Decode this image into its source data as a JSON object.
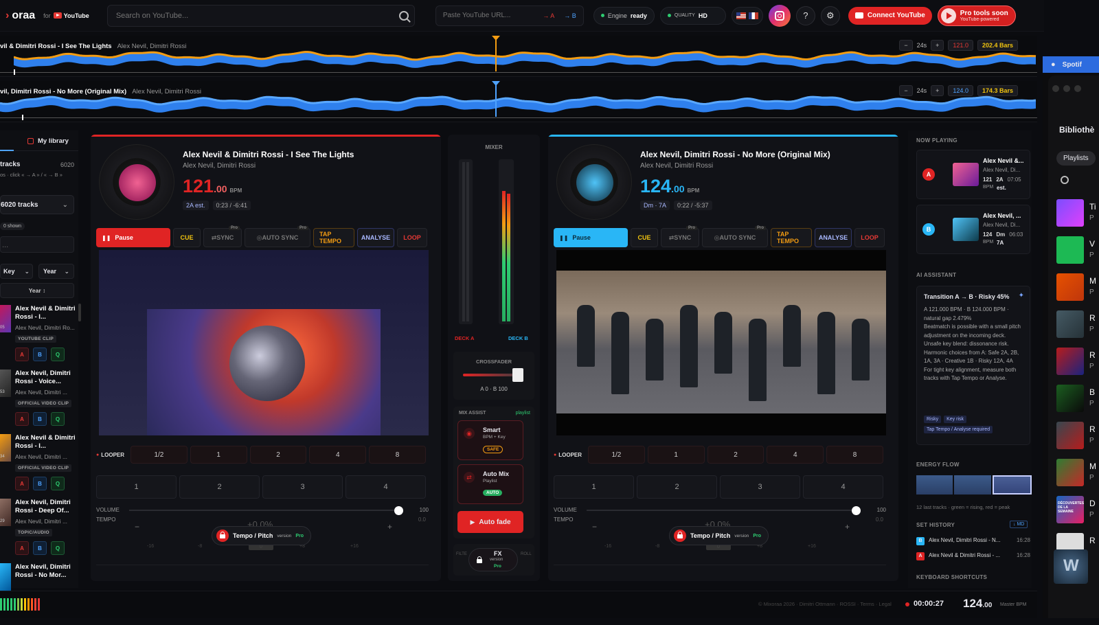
{
  "header": {
    "logo": "oraa",
    "logo_prefix": "",
    "for_label": "for",
    "youtube_label": "YouTube",
    "search_placeholder": "Search on YouTube...",
    "url_placeholder": "Paste YouTube URL...",
    "to_a": "→ A",
    "to_b": "→ B",
    "engine_label": "Engine",
    "engine_status": "ready",
    "quality_label": "QUALITY",
    "quality_value": "HD",
    "connect_label": "Connect YouTube",
    "pro_title": "Pro tools soon",
    "pro_sub": "YouTube-powered"
  },
  "waveforms": [
    {
      "title": "vil & Dimitri Rossi - I See The Lights",
      "artist": "Alex Nevil, Dimitri Rossi",
      "window": "24s",
      "bpm": "121.0",
      "bars": "202.4 Bars"
    },
    {
      "title": "vil, Dimitri Rossi - No More (Original Mix)",
      "artist": "Alex Nevil, Dimitri Rossi",
      "window": "24s",
      "bpm": "124.0",
      "bars": "174.3 Bars"
    }
  ],
  "sidebar": {
    "tab_label": "My library",
    "tracks_label": "tracks",
    "tracks_count": "6020",
    "hint": "os · click « → A » / « → B »",
    "dropdown": "6020 tracks",
    "shown_label": "0 shown",
    "filter_key": "Key",
    "filter_year": "Year",
    "sort_label": "Year ↕",
    "items": [
      {
        "title": "Alex Nevil & Dimitri Rossi - I...",
        "artist": "Alex Nevil, Dimitri Ro...",
        "tag": "YOUTUBE CLIP",
        "num": "05"
      },
      {
        "title": "Alex Nevil, Dimitri Rossi - Voice...",
        "artist": "Alex Nevil, Dimitri ...",
        "tag": "OFFICIAL VIDEO CLIP",
        "num": "53"
      },
      {
        "title": "Alex Nevil & Dimitri Rossi - I...",
        "artist": "Alex Nevil, Dimitri ...",
        "tag": "OFFICIAL VIDEO CLIP",
        "num": "34"
      },
      {
        "title": "Alex Nevil, Dimitri Rossi - Deep Of...",
        "artist": "Alex Nevil, Dimitri ...",
        "tag": "TOPIC/AUDIO",
        "num": "29"
      },
      {
        "title": "Alex Nevil, Dimitri Rossi - No Mor...",
        "artist": "",
        "tag": "",
        "num": ""
      }
    ],
    "btn_a": "A",
    "btn_b": "B",
    "btn_q": "Q"
  },
  "deckA": {
    "title": "Alex Nevil & Dimitri Rossi - I See The Lights",
    "artist": "Alex Nevil, Dimitri Rossi",
    "bpm": "121",
    "bpm_dec": ".00",
    "bpm_unit": "BPM",
    "key": "2A est.",
    "time": "0:23 / -6:41",
    "pause": "Pause",
    "cue": "CUE",
    "sync": "SYNC",
    "autosync": "AUTO SYNC",
    "tap": "TAP TEMPO",
    "analyse": "ANALYSE",
    "loop": "LOOP",
    "pro": "Pro",
    "looper_label": "LOOPER",
    "loops": [
      "1/2",
      "1",
      "2",
      "4",
      "8"
    ],
    "cues": [
      "1",
      "2",
      "3",
      "4"
    ],
    "volume_label": "VOLUME",
    "volume": 100,
    "volume_value": "100",
    "tempo_label": "TEMPO",
    "tempo_value": "+0.0%",
    "tempo_side": "0.0",
    "tp_label": "Tempo / Pitch",
    "tp_version": "version",
    "tp_pro": "Pro",
    "ticks": [
      "-16",
      "-8",
      "0",
      "+8",
      "+16"
    ],
    "accent": "#e02424"
  },
  "deckB": {
    "title": "Alex Nevil, Dimitri Rossi - No More (Original Mix)",
    "artist": "Alex Nevil, Dimitri Rossi",
    "bpm": "124",
    "bpm_dec": ".00",
    "bpm_unit": "BPM",
    "key": "Dm · 7A",
    "time": "0:22 / -5:37",
    "pause": "Pause",
    "cue": "CUE",
    "sync": "SYNC",
    "autosync": "AUTO SYNC",
    "tap": "TAP TEMPO",
    "analyse": "ANALYSE",
    "loop": "LOOP",
    "pro": "Pro",
    "looper_label": "LOOPER",
    "loops": [
      "1/2",
      "1",
      "2",
      "4",
      "8"
    ],
    "cues": [
      "1",
      "2",
      "3",
      "4"
    ],
    "volume_label": "VOLUME",
    "volume": 100,
    "volume_value": "100",
    "tempo_label": "TEMPO",
    "tempo_value": "+0.0%",
    "tempo_side": "0.0",
    "tp_label": "Tempo / Pitch",
    "tp_version": "version",
    "tp_pro": "Pro",
    "ticks": [
      "-16",
      "-8",
      "0",
      "+8",
      "+16"
    ],
    "accent": "#29b6f6"
  },
  "mixer": {
    "title": "MIXER",
    "deck_a": "DECK A",
    "deck_b": "DECK B",
    "crossfader_label": "CROSSFADER",
    "crossfader_value": "A 0 · B 100",
    "mix_assist": "MIX ASSIST",
    "playlist_tag": "playlist",
    "smart_title": "Smart",
    "smart_sub": "BPM + Key",
    "smart_badge": "SAFE",
    "auto_title": "Auto Mix",
    "auto_sub": "Playlist",
    "auto_badge": "AUTO",
    "autofade": "Auto fade",
    "fx_title": "FX",
    "fx_version": "version",
    "fx_pro": "Pro",
    "filter_label": "FILTE",
    "roll_label": "ROLL",
    "level_b": 0.82
  },
  "rightpanel": {
    "now_playing": "NOW PLAYING",
    "np": [
      {
        "badge": "A",
        "title": "Alex Nevil &...",
        "artist": "Alex Nevil, Di...",
        "bpm": "121",
        "key": "2A",
        "dur": "07:05",
        "bpm_unit": "BPM",
        "extra": "est."
      },
      {
        "badge": "B",
        "title": "Alex Nevil, ...",
        "artist": "Alex Nevil, Di...",
        "bpm": "124",
        "key": "Dm",
        "dur": "06:03",
        "bpm_unit": "BPM",
        "extra": "7A"
      }
    ],
    "ai_label": "AI ASSISTANT",
    "ai_title": "Transition A → B · Risky 45%",
    "ai_lines": [
      "A 121.000 BPM · B 124.000 BPM · natural gap 2.479%",
      "Beatmatch is possible with a small pitch adjustment on the incoming deck.",
      "Unsafe key blend: dissonance risk. Harmonic choices from A: Safe 2A, 2B, 1A, 3A · Creative 1B · Risky 12A, 4A",
      "For tight key alignment, measure both tracks with Tap Tempo or Analyse."
    ],
    "ai_tags": [
      "Risky",
      "Key risk",
      "Tap Tempo / Analyse required"
    ],
    "energy_label": "ENERGY FLOW",
    "energy_note": "12 last tracks · green = rising, red = peak",
    "history_label": "SET HISTORY",
    "history_btn": "↓ MD",
    "history": [
      {
        "badge": "B",
        "title": "Alex Nevil, Dimitri Rossi - N...",
        "time": "16:28"
      },
      {
        "badge": "A",
        "title": "Alex Nevil & Dimitri Rossi - ...",
        "time": "16:28"
      }
    ],
    "shortcuts_label": "KEYBOARD SHORTCUTS"
  },
  "spotify": {
    "tab_label": "Spotif",
    "library": "Bibliothè",
    "playlists": "Playlists",
    "items": [
      {
        "l": "Ti",
        "s": "P"
      },
      {
        "l": "V",
        "s": "P"
      },
      {
        "l": "M",
        "s": "P"
      },
      {
        "l": "R",
        "s": "P"
      },
      {
        "l": "R",
        "s": "P"
      },
      {
        "l": "B",
        "s": "P"
      },
      {
        "l": "R",
        "s": "P"
      },
      {
        "l": "M",
        "s": "P"
      },
      {
        "l": "D",
        "s": "P"
      },
      {
        "l": "R",
        "s": ""
      }
    ],
    "thumb_text": "DÉCOUVERTES DE LA SEMAINE"
  },
  "footer": {
    "copyright": "© Mixoraa 2026 · Dimitri Ottmann · ROSSI · Terms · Legal",
    "clock": "00:00:27",
    "master_bpm": "124",
    "master_dec": ".00",
    "master_label": "Master BPM"
  },
  "colors": {
    "deckA": "#e02424",
    "deckB": "#29b6f6",
    "wave_orange": "#f39c12",
    "wave_blue": "#2f80ed"
  }
}
